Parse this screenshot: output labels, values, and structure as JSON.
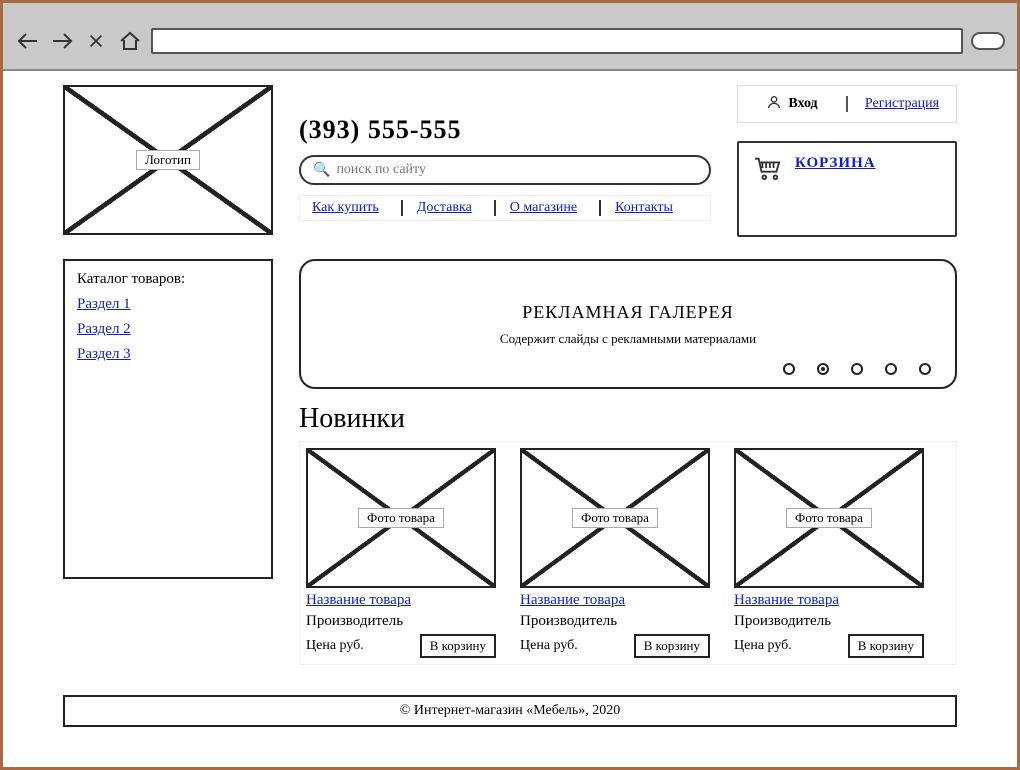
{
  "browser": {
    "url": ""
  },
  "header": {
    "logo_label": "Логотип",
    "phone": "(393) 555-555",
    "search_placeholder": "поиск по сайту",
    "info_links": [
      "Как купить",
      "Доставка",
      "О магазине",
      "Контакты"
    ],
    "auth": {
      "login": "Вход",
      "register": "Регистрация"
    },
    "cart_label": "КОРЗИНА"
  },
  "catalog": {
    "title": "Каталог товаров:",
    "sections": [
      "Раздел 1",
      "Раздел 2",
      "Раздел 3"
    ]
  },
  "banner": {
    "title": "РЕКЛАМНАЯ ГАЛЕРЕЯ",
    "subtitle": "Содержит слайды с рекламными материалами",
    "dots": 5,
    "active_dot": 1
  },
  "novinki": {
    "heading": "Новинки",
    "products": [
      {
        "img_label": "Фото товара",
        "name": "Название товара",
        "maker": "Производитель",
        "price": "Цена руб.",
        "btn": "В корзину"
      },
      {
        "img_label": "Фото товара",
        "name": "Название товара",
        "maker": "Производитель",
        "price": "Цена руб.",
        "btn": "В корзину"
      },
      {
        "img_label": "Фото товара",
        "name": "Название товара",
        "maker": "Производитель",
        "price": "Цена руб.",
        "btn": "В корзину"
      }
    ]
  },
  "footer": "© Интернет-магазин «Мебель», 2020"
}
